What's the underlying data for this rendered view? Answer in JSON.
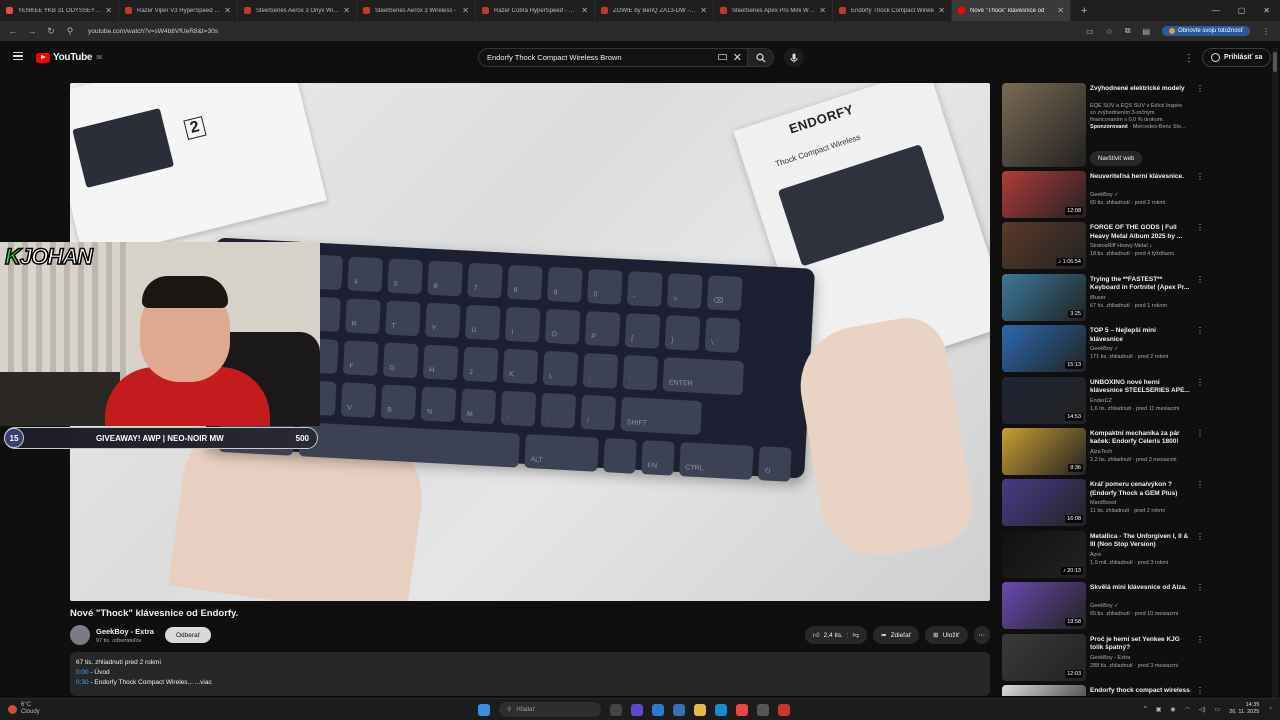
{
  "browser": {
    "tabs": [
      {
        "title": "YENKEE YKB 31 ODYSSEY Hotsw",
        "color": "#e74c3c"
      },
      {
        "title": "Razer Viper V3 HyperSpeed za",
        "color": "#c0392b"
      },
      {
        "title": "SteelSeries Aerox 3 Onyx Wirel",
        "color": "#c0392b"
      },
      {
        "title": "SteelSeries Aerox 3 Wireless -",
        "color": "#c0392b"
      },
      {
        "title": "Razer Cobra HyperSpeed - Hern",
        "color": "#c0392b"
      },
      {
        "title": "ZOWIE by BenQ ZA13-DW - Hern",
        "color": "#c0392b"
      },
      {
        "title": "SteelSeries Apex Pro Mini Wire",
        "color": "#c0392b"
      },
      {
        "title": "Endorfy Thock Compact Wirele",
        "color": "#c0392b"
      },
      {
        "title": "Nové \"Thock\" klávesnice od",
        "color": "#ff0000",
        "active": true
      }
    ],
    "new_tab": "+",
    "url": "youtube.com/watch?v=sW4b8VfUeR8&t=30s",
    "restore_label": "Obnovte svoju totožnosť"
  },
  "youtube": {
    "logo_text": "YouTube",
    "region": "SK",
    "search_value": "Endorfy Thock Compact Wireless Brown",
    "sign_in": "Prihlásiť sa"
  },
  "player": {
    "box_brand": "ENDORFY",
    "box_product": "Thock Compact Wireless",
    "warranty": "2",
    "webcam_name_k": "K",
    "webcam_name": "JOHAN",
    "giveaway_num": "15",
    "giveaway_text": "GIVEAWAY! AWP | NEO-NOIR MW",
    "giveaway_count": "500",
    "keys": [
      [
        "1",
        "2",
        "3",
        "4",
        "5",
        "6",
        "7",
        "8",
        "9",
        "0",
        "-",
        "=",
        "⌫"
      ],
      [
        "Q",
        "W",
        "E",
        "R",
        "T",
        "Y",
        "U",
        "I",
        "O",
        "P",
        "[",
        "]",
        "\\"
      ],
      [
        "A",
        "S",
        "D",
        "F",
        "G",
        "H",
        "J",
        "K",
        "L",
        ";",
        "'",
        "ENTER"
      ],
      [
        "Z",
        "X",
        "C",
        "V",
        "B",
        "N",
        "M",
        ",",
        ".",
        "/",
        "SHIFT"
      ],
      [
        "CTRL",
        "",
        "ALT",
        "",
        "FN",
        "CTRL",
        "⏻"
      ]
    ]
  },
  "video": {
    "title": "Nové \"Thock\" klávesnice od Endorfy.",
    "channel": "GeekBoy - Extra",
    "subscribers": "97 tis. odberateľov",
    "subscribe": "Odberať",
    "likes": "2,4 tis.",
    "share": "Zdieľať",
    "save": "Uložiť",
    "views_date": "67 tis. zhliadnutí  pred 2 rokmi",
    "chapter1_time": "0:00",
    "chapter1_label": " - Úvod",
    "chapter2_time": "0:30",
    "chapter2_label": " - Endorfy Thock Compact Wireles... ...viac"
  },
  "recommendations": [
    {
      "title": "Zvýhodnené elektrické modely",
      "line1": "EQE SUV a EQS SUV v Edícii Inspire",
      "line2": "so zvýhodnením 3-ročným",
      "line3": "financovaním s 0,0 % úrokom.",
      "sponsor": "Sponzorované",
      "sponsor_name": " · Mercedes-Benz Slo...",
      "button": "Navštíviť web",
      "thumb": "#7a6a55",
      "ad": true
    },
    {
      "title": "Neuveriteľná herní klávesnice.",
      "channel": "GeekBoy ✓",
      "meta": "65 tis. zhliadnutí · pred 2 rokmi",
      "duration": "12:08",
      "thumb": "#b33a3a"
    },
    {
      "title": "FORGE OF THE GODS | Full Heavy Metal Album 2025 by ...",
      "channel": "StratosRiff Heavy Metal ♪",
      "meta": "18 tis. zhliadnutí · pred 4 týždňami",
      "duration": "♪ 1:06:54",
      "thumb": "#5a3a2a"
    },
    {
      "title": "Trying the **FASTEST** Keyboard in Fortnite! (Apex Pr...",
      "channel": "iBuser",
      "meta": "67 tis. zhliadnutí · pred 1 rokom",
      "duration": "3:25",
      "thumb": "#3a7a9a"
    },
    {
      "title": "TOP 5 – Nejlepší mini klávesnice",
      "channel": "GeekBoy ✓",
      "meta": "171 tis. zhliadnutí · pred 2 rokmi",
      "duration": "15:13",
      "thumb": "#2a6ab0"
    },
    {
      "title": "UNBOXING nové herní klávesnice STEELSERIES APE...",
      "channel": "EnderCZ",
      "meta": "1,6 tis. zhliadnutí · pred 11 mesiacmi",
      "duration": "14:53",
      "thumb": "#1f2535"
    },
    {
      "title": "Kompaktní mechanika za pár kaček: Endorfy Celeris 1800!",
      "channel": "AlzaTech",
      "meta": "2,2 tis. zhliadnutí · pred 3 mesiacmi",
      "duration": "8:36",
      "thumb": "#c8a030"
    },
    {
      "title": "Kráľ pomeru cena/výkon ? (Endorfy Thock a GEM Plus)",
      "channel": "MarsBoost",
      "meta": "11 tis. zhliadnutí · pred 2 rokmi",
      "duration": "16:08",
      "thumb": "#4a3a8a"
    },
    {
      "title": "Metallica - The Unforgiven I, II & III (Non Stop Version)",
      "channel": "Azre",
      "meta": "1,9 mil. zhliadnutí · pred 3 rokmi",
      "duration": "♪ 20:13",
      "thumb": "#111111"
    },
    {
      "title": "Skvělá mini klávesnice od Alza.",
      "channel": "GeekBoy ✓",
      "meta": "65 tis. zhliadnutí · pred 10 mesiacmi",
      "duration": "19:58",
      "thumb": "#6a4ab0"
    },
    {
      "title": "Proč je herní set Yenkee KJG tolik špatný?",
      "channel": "GeekBoy - Extra",
      "meta": "288 tis. zhliadnutí · pred 3 mesiacmi",
      "duration": "12:03",
      "thumb": "#3a3a3a"
    },
    {
      "title": "Endorfy thock compact wireless",
      "channel": "",
      "meta": "",
      "duration": "",
      "thumb": "#dddddd"
    }
  ],
  "taskbar": {
    "temp": "6°C",
    "weather": "Cloudy",
    "search": "Hľadať",
    "time": "14:35",
    "date": "26. 11. 2025"
  }
}
